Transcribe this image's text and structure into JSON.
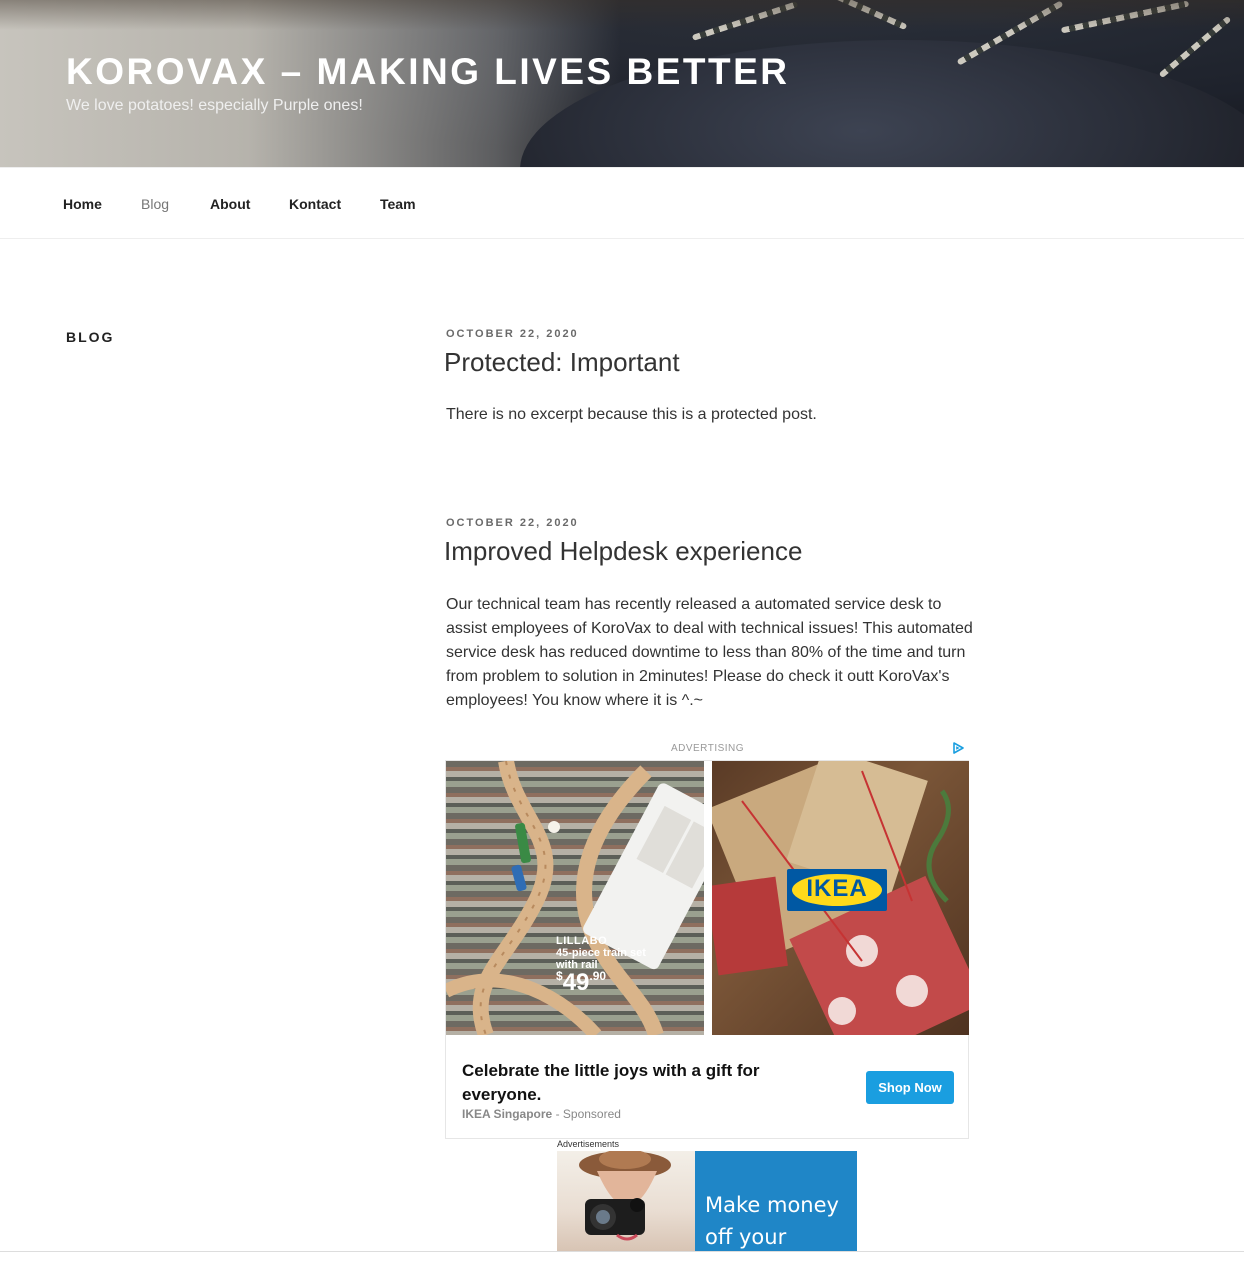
{
  "header": {
    "title": "KOROVAX – MAKING LIVES BETTER",
    "description": "We love potatoes! especially Purple ones!"
  },
  "nav": {
    "items": [
      {
        "label": "Home"
      },
      {
        "label": "Blog",
        "current": true
      },
      {
        "label": "About"
      },
      {
        "label": "Kontact"
      },
      {
        "label": "Team"
      }
    ]
  },
  "page": {
    "heading": "BLOG"
  },
  "posts": [
    {
      "date": "OCTOBER 22, 2020",
      "title": "Protected: Important",
      "excerpt": "There is no excerpt because this is a protected post."
    },
    {
      "date": "OCTOBER 22, 2020",
      "title": "Improved Helpdesk experience",
      "excerpt": "Our technical team has recently released a automated service desk to assist employees of KoroVax to deal with technical issues! This automated service desk has reduced downtime to less than 80% of the time and turn from problem to solution in 2minutes! Please do check it outt KoroVax's employees! You know where it is ^.~"
    }
  ],
  "ad": {
    "label": "ADVERTISING",
    "product_name": "LILLABO",
    "product_desc_1": "45-piece train set",
    "product_desc_2": "with rail",
    "price_currency": "$",
    "price_main": "49",
    "price_cents": ".90",
    "brand_logo": "IKEA",
    "caption": "Celebrate the little joys with a gift for everyone.",
    "advertiser": "IKEA Singapore",
    "sponsored": " - Sponsored",
    "cta": "Shop Now",
    "colors": {
      "cta": "#1a9ee0",
      "ikea_blue": "#0058a3",
      "ikea_yellow": "#ffda1a"
    }
  },
  "ads_section": {
    "label": "Advertisements",
    "banner_text": "Make money\noff your",
    "colors": {
      "banner_blue": "#1f86c7"
    }
  }
}
